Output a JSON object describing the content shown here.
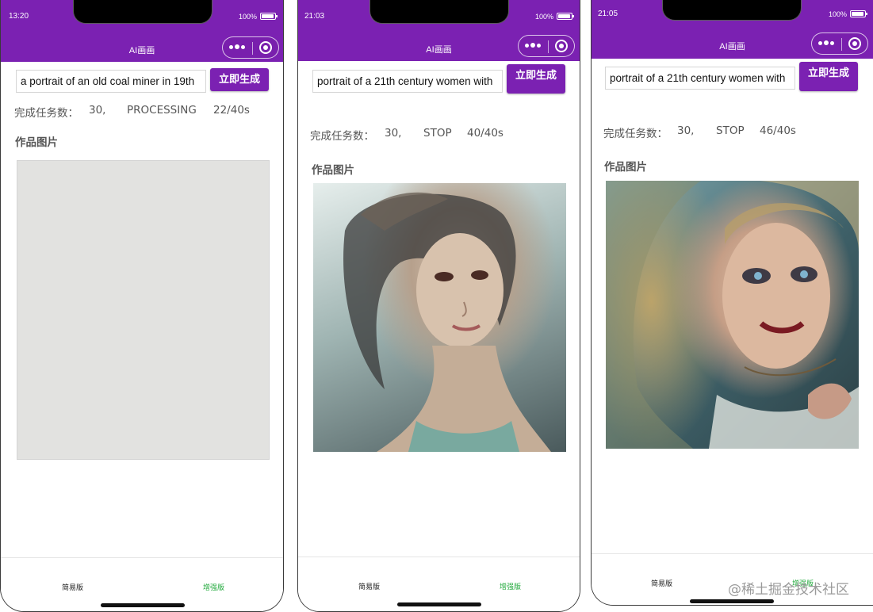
{
  "app": {
    "nav_title": "AI画画",
    "generate_label": "立即生成",
    "stats_label": "完成任务数：",
    "gallery_label": "作品图片",
    "tabs": [
      "简易版",
      "增强版"
    ],
    "accent_color": "#7b21b2",
    "active_tab_color": "#1fa83a"
  },
  "phones": [
    {
      "time": "13:20",
      "battery": "100%",
      "prompt": "a portrait of an old coal miner in 19th",
      "count": "30,",
      "status": "PROCESSING",
      "progress": "22/40s",
      "image_state": "loading"
    },
    {
      "time": "21:03",
      "battery": "100%",
      "prompt": "portrait of a 21th century women with",
      "count": "30,",
      "status": "STOP",
      "progress": "40/40s",
      "image_state": "generated"
    },
    {
      "time": "21:05",
      "battery": "100%",
      "prompt": "portrait of a 21th century women with",
      "count": "30,",
      "status": "STOP",
      "progress": "46/40s",
      "image_state": "generated"
    }
  ],
  "watermark": "@稀土掘金技术社区"
}
